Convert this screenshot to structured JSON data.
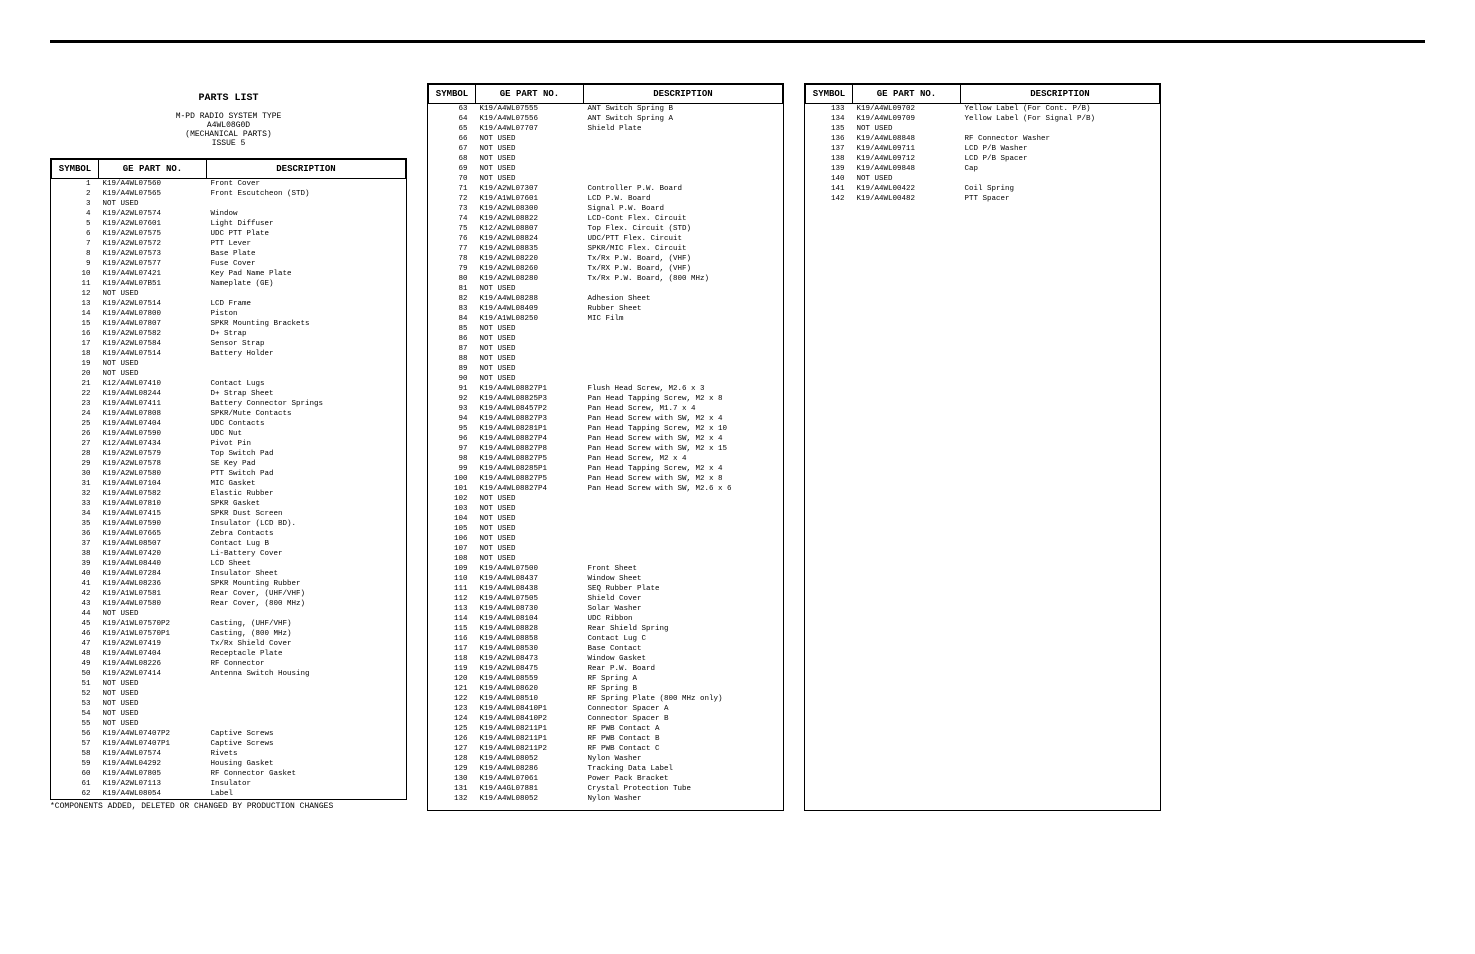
{
  "title": "PARTS LIST",
  "subtitle1": "M-PD RADIO SYSTEM TYPE",
  "subtitle2": "A4WL08G0D",
  "subtitle3": "(MECHANICAL PARTS)",
  "subtitle4": "ISSUE 5",
  "headers": {
    "symbol": "SYMBOL",
    "part": "GE PART NO.",
    "desc": "DESCRIPTION"
  },
  "footnote": "*COMPONENTS ADDED, DELETED OR CHANGED BY PRODUCTION CHANGES",
  "col1": [
    [
      "1",
      "K19/A4WL07560",
      "Front Cover"
    ],
    [
      "2",
      "K19/A4WL07565",
      "Front Escutcheon (STD)"
    ],
    [
      "3",
      "NOT USED",
      ""
    ],
    [
      "4",
      "K19/A2WL07574",
      "Window"
    ],
    [
      "5",
      "K19/A2WL07601",
      "Light Diffuser"
    ],
    [
      "6",
      "K19/A2WL07575",
      "UDC PTT Plate"
    ],
    [
      "7",
      "K19/A2WL07572",
      "PTT Lever"
    ],
    [
      "8",
      "K19/A2WL07573",
      "Base Plate"
    ],
    [
      "9",
      "K19/A2WL07577",
      "Fuse Cover"
    ],
    [
      "10",
      "K19/A4WL07421",
      "Key Pad Name Plate"
    ],
    [
      "11",
      "K19/A4WL07B51",
      "Nameplate (GE)"
    ],
    [
      "12",
      "NOT USED",
      ""
    ],
    [
      "13",
      "K19/A2WL07514",
      "LCD Frame"
    ],
    [
      "14",
      "K19/A4WL07800",
      "Piston"
    ],
    [
      "15",
      "K19/A4WL07807",
      "SPKR Mounting Brackets"
    ],
    [
      "16",
      "K19/A2WL07582",
      "D+ Strap"
    ],
    [
      "17",
      "K19/A2WL07584",
      "Sensor Strap"
    ],
    [
      "18",
      "K19/A4WL07514",
      "Battery Holder"
    ],
    [
      "19",
      "NOT USED",
      ""
    ],
    [
      "20",
      "NOT USED",
      ""
    ],
    [
      "21",
      "K12/A4WL07410",
      "Contact Lugs"
    ],
    [
      "22",
      "K19/A4WL08244",
      "D+ Strap Sheet"
    ],
    [
      "23",
      "K19/A4WL07411",
      "Battery Connector Springs"
    ],
    [
      "24",
      "K19/A4WL07808",
      "SPKR/Mute Contacts"
    ],
    [
      "25",
      "K19/A4WL07404",
      "UDC Contacts"
    ],
    [
      "26",
      "K19/A4WL07590",
      "UDC Nut"
    ],
    [
      "27",
      "K12/A4WL07434",
      "Pivot Pin"
    ],
    [
      "28",
      "K19/A2WL07579",
      "Top Switch Pad"
    ],
    [
      "29",
      "K19/A2WL07578",
      "SE Key Pad"
    ],
    [
      "30",
      "K19/A2WL07580",
      "PTT Switch Pad"
    ],
    [
      "31",
      "K19/A4WL07104",
      "MIC Gasket"
    ],
    [
      "32",
      "K19/A4WL07582",
      "Elastic Rubber"
    ],
    [
      "33",
      "K19/A4WL07810",
      "SPKR Gasket"
    ],
    [
      "34",
      "K19/A4WL07415",
      "SPKR Dust Screen"
    ],
    [
      "35",
      "K19/A4WL07590",
      "Insulator (LCD BD)."
    ],
    [
      "36",
      "K19/A4WL07665",
      "Zebra Contacts"
    ],
    [
      "37",
      "K19/A4WL08507",
      "Contact Lug B"
    ],
    [
      "38",
      "K19/A4WL07420",
      "Li-Battery Cover"
    ],
    [
      "39",
      "K19/A4WL08440",
      "LCD Sheet"
    ],
    [
      "40",
      "K19/A4WL07284",
      "Insulator Sheet"
    ],
    [
      "41",
      "K19/A4WL08236",
      "SPKR Mounting Rubber"
    ],
    [
      "42",
      "K19/A1WL07581",
      "Rear Cover, (UHF/VHF)"
    ],
    [
      "43",
      "K19/A4WL07580",
      "Rear Cover, (800 MHz)"
    ],
    [
      "44",
      "NOT USED",
      ""
    ],
    [
      "45",
      "K19/A1WL07570P2",
      "Casting, (UHF/VHF)"
    ],
    [
      "46",
      "K19/A1WL07570P1",
      "Casting, (800 MHz)"
    ],
    [
      "47",
      "K19/A2WL07419",
      "Tx/Rx Shield Cover"
    ],
    [
      "48",
      "K19/A4WL07404",
      "Receptacle Plate"
    ],
    [
      "49",
      "K19/A4WL08226",
      "RF Connector"
    ],
    [
      "50",
      "K19/A2WL07414",
      "Antenna Switch Housing"
    ],
    [
      "51",
      "NOT USED",
      ""
    ],
    [
      "52",
      "NOT USED",
      ""
    ],
    [
      "53",
      "NOT USED",
      ""
    ],
    [
      "54",
      "NOT USED",
      ""
    ],
    [
      "55",
      "NOT USED",
      ""
    ],
    [
      "56",
      "K19/A4WL07407P2",
      "Captive Screws"
    ],
    [
      "57",
      "K19/A4WL07407P1",
      "Captive Screws"
    ],
    [
      "58",
      "K19/A4WL07574",
      "Rivets"
    ],
    [
      "59",
      "K19/A4WL04292",
      "Housing Gasket"
    ],
    [
      "60",
      "K19/A4WL07805",
      "RF Connector Gasket"
    ],
    [
      "61",
      "K19/A2WL07113",
      "Insulator"
    ],
    [
      "62",
      "K19/A4WL08054",
      "Label"
    ]
  ],
  "col2": [
    [
      "63",
      "K19/A4WL07555",
      "ANT Switch Spring B"
    ],
    [
      "64",
      "K19/A4WL07556",
      "ANT Switch Spring A"
    ],
    [
      "65",
      "K19/A4WL07707",
      "Shield Plate"
    ],
    [
      "66",
      "NOT USED",
      ""
    ],
    [
      "67",
      "NOT USED",
      ""
    ],
    [
      "68",
      "NOT USED",
      ""
    ],
    [
      "69",
      "NOT USED",
      ""
    ],
    [
      "70",
      "NOT USED",
      ""
    ],
    [
      "71",
      "K19/A2WL07307",
      "Controller P.W. Board"
    ],
    [
      "72",
      "K19/A1WL07601",
      "LCD P.W. Board"
    ],
    [
      "73",
      "K19/A2WL08300",
      "Signal P.W. Board"
    ],
    [
      "74",
      "K19/A2WL08822",
      "LCD-Cont Flex. Circuit"
    ],
    [
      "75",
      "K12/A2WL08807",
      "Top Flex. Circuit (STD)"
    ],
    [
      "76",
      "K19/A2WL08824",
      "UDC/PTT Flex. Circuit"
    ],
    [
      "77",
      "K19/A2WL08835",
      "SPKR/MIC Flex. Circuit"
    ],
    [
      "78",
      "K19/A2WL08220",
      "Tx/Rx P.W. Board, (VHF)"
    ],
    [
      "79",
      "K19/A2WL08260",
      "Tx/RX P.W. Board, (VHF)"
    ],
    [
      "80",
      "K19/A2WL08280",
      "Tx/Rx P.W. Board, (800 MHz)"
    ],
    [
      "81",
      "NOT USED",
      ""
    ],
    [
      "82",
      "K19/A4WL08288",
      "Adhesion Sheet"
    ],
    [
      "83",
      "K19/A4WL08409",
      "Rubber Sheet"
    ],
    [
      "84",
      "K19/A1WL08250",
      "MIC Film"
    ],
    [
      "85",
      "NOT USED",
      ""
    ],
    [
      "86",
      "NOT USED",
      ""
    ],
    [
      "87",
      "NOT USED",
      ""
    ],
    [
      "88",
      "NOT USED",
      ""
    ],
    [
      "89",
      "NOT USED",
      ""
    ],
    [
      "90",
      "NOT USED",
      ""
    ],
    [
      "91",
      "K19/A4WL08827P1",
      "Flush Head Screw, M2.6 x 3"
    ],
    [
      "92",
      "K19/A4WL08825P3",
      "Pan Head Tapping Screw, M2 x 8"
    ],
    [
      "93",
      "K19/A4WL08457P2",
      "Pan Head Screw, M1.7 x 4"
    ],
    [
      "94",
      "K19/A4WL08827P3",
      "Pan Head Screw with SW, M2 x 4"
    ],
    [
      "95",
      "K19/A4WL08281P1",
      "Pan Head Tapping Screw, M2 x 10"
    ],
    [
      "96",
      "K19/A4WL08827P4",
      "Pan Head Screw with SW, M2 x 4"
    ],
    [
      "97",
      "K19/A4WL08827P8",
      "Pan Head Screw with SW, M2 x 15"
    ],
    [
      "98",
      "K19/A4WL08827P5",
      "Pan Head Screw, M2 x 4"
    ],
    [
      "99",
      "K19/A4WL08285P1",
      "Pan Head Tapping Screw, M2 x 4"
    ],
    [
      "100",
      "K19/A4WL08827P5",
      "Pan Head Screw with SW, M2 x 8"
    ],
    [
      "101",
      "K19/A4WL08827P4",
      "Pan Head Screw with SW, M2.6 x 6"
    ],
    [
      "102",
      "NOT USED",
      ""
    ],
    [
      "103",
      "NOT USED",
      ""
    ],
    [
      "104",
      "NOT USED",
      ""
    ],
    [
      "105",
      "NOT USED",
      ""
    ],
    [
      "106",
      "NOT USED",
      ""
    ],
    [
      "107",
      "NOT USED",
      ""
    ],
    [
      "108",
      "NOT USED",
      ""
    ],
    [
      "109",
      "K19/A4WL07500",
      "Front Sheet"
    ],
    [
      "110",
      "K19/A4WL08437",
      "Window Sheet"
    ],
    [
      "111",
      "K19/A4WL08438",
      "SEQ Rubber Plate"
    ],
    [
      "112",
      "K19/A4WL07505",
      "Shield Cover"
    ],
    [
      "113",
      "K19/A4WL08730",
      "Solar Washer"
    ],
    [
      "114",
      "K19/A4WL08104",
      "UDC Ribbon"
    ],
    [
      "115",
      "K19/A4WL08828",
      "Rear Shield Spring"
    ],
    [
      "116",
      "K19/A4WL08858",
      "Contact Lug C"
    ],
    [
      "117",
      "K19/A4WL08530",
      "Base Contact"
    ],
    [
      "118",
      "K19/A2WL08473",
      "Window Gasket"
    ],
    [
      "119",
      "K19/A2WL08475",
      "Rear P.W. Board"
    ],
    [
      "120",
      "K19/A4WL08559",
      "RF Spring A"
    ],
    [
      "121",
      "K19/A4WL08620",
      "RF Spring B"
    ],
    [
      "122",
      "K19/A4WL08510",
      "RF Spring Plate (800 MHz only)"
    ],
    [
      "123",
      "K19/A4WL08410P1",
      "Connector Spacer A"
    ],
    [
      "124",
      "K19/A4WL08410P2",
      "Connector Spacer B"
    ],
    [
      "125",
      "K19/A4WL08211P1",
      "RF PWB Contact A"
    ],
    [
      "126",
      "K19/A4WL08211P1",
      "RF PWB Contact B"
    ],
    [
      "127",
      "K19/A4WL08211P2",
      "RF PWB Contact C"
    ],
    [
      "128",
      "K19/A4WL08052",
      "Nylon Washer"
    ],
    [
      "129",
      "K19/A4WL08286",
      "Tracking Data Label"
    ],
    [
      "130",
      "K19/A4WL07061",
      "Power Pack Bracket"
    ],
    [
      "131",
      "K19/A4GL07881",
      "Crystal Protection Tube"
    ],
    [
      "132",
      "K19/A4WL08052",
      "Nylon Washer"
    ]
  ],
  "col3": [
    [
      "133",
      "K19/A4WL09702",
      "Yellow Label (For Cont. P/B)"
    ],
    [
      "134",
      "K19/A4WL09709",
      "Yellow Label (For Signal P/B)"
    ],
    [
      "135",
      "NOT USED",
      ""
    ],
    [
      "136",
      "K19/A4WL08848",
      "RF Connector Washer"
    ],
    [
      "137",
      "K19/A4WL09711",
      "LCD P/B Washer"
    ],
    [
      "138",
      "K19/A4WL09712",
      "LCD P/B Spacer"
    ],
    [
      "139",
      "K19/A4WL09848",
      "Cap"
    ],
    [
      "140",
      "NOT USED",
      ""
    ],
    [
      "141",
      "K19/A4WL00422",
      "Coil Spring"
    ],
    [
      "142",
      "K19/A4WL00482",
      "PTT Spacer"
    ]
  ]
}
